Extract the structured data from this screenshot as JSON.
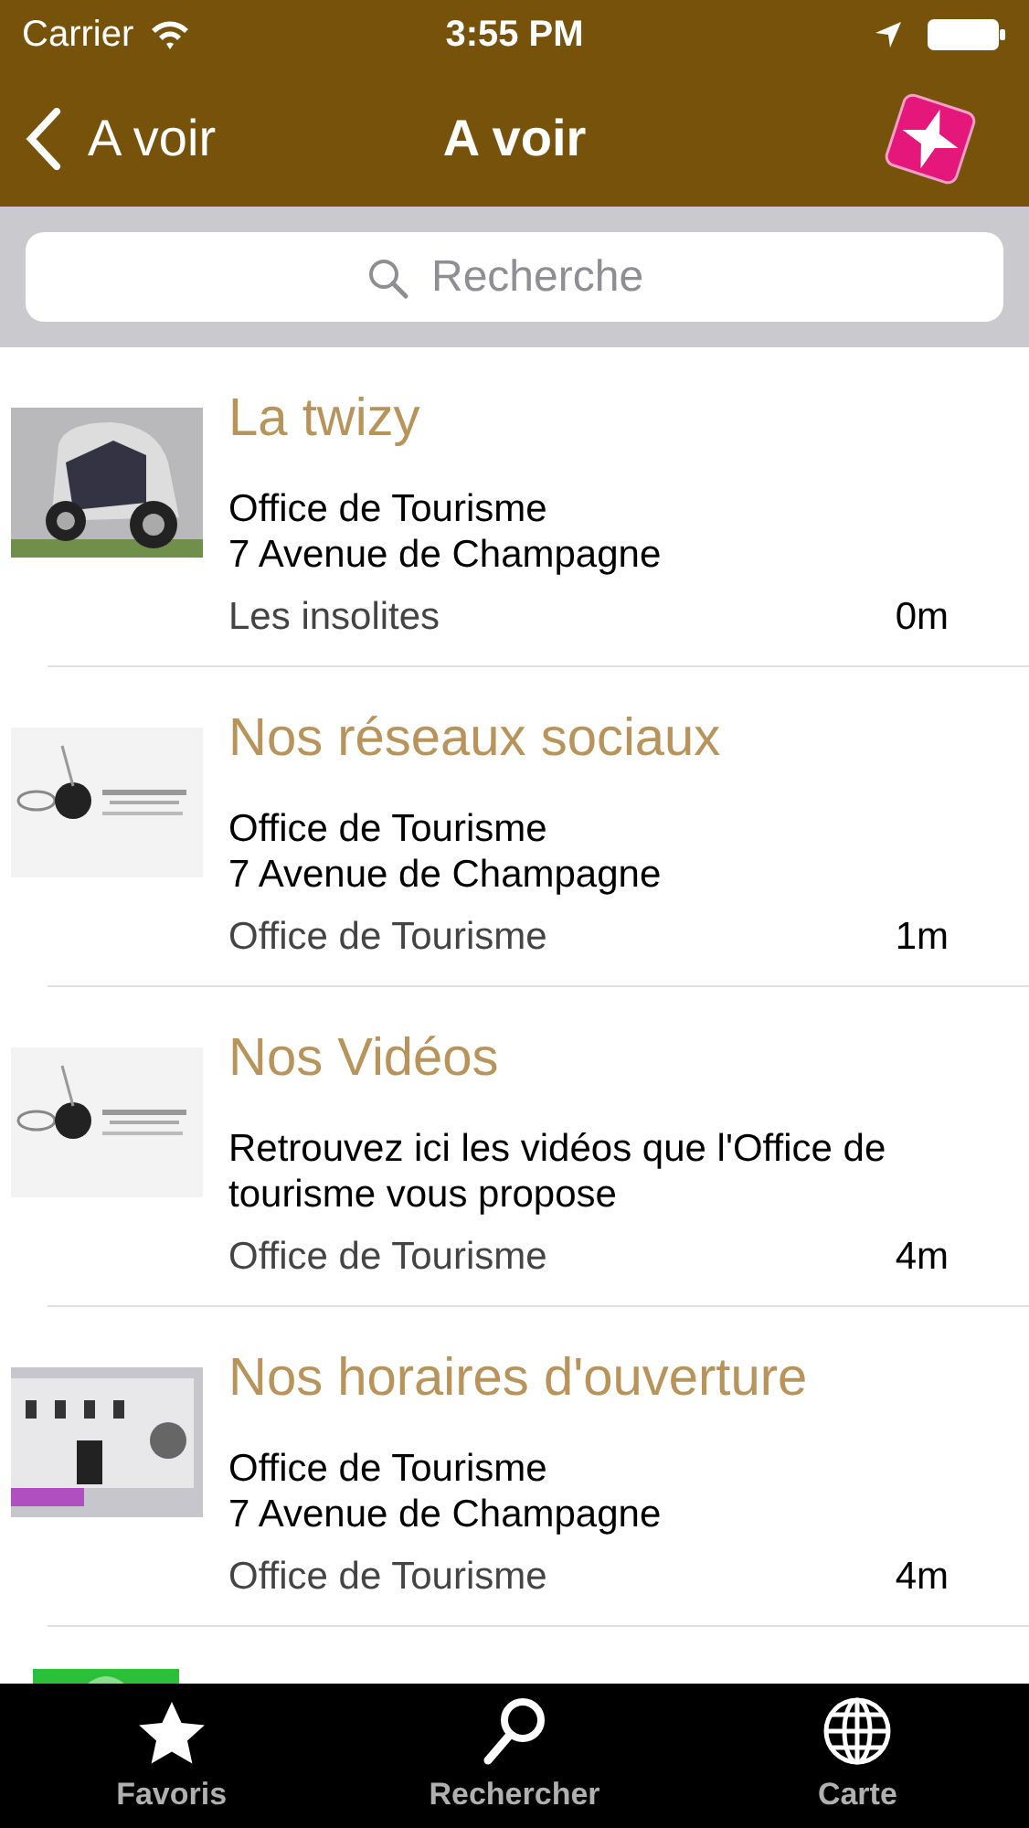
{
  "status_bar": {
    "carrier": "Carrier",
    "time": "3:55 PM"
  },
  "nav": {
    "back": "A voir",
    "title": "A voir"
  },
  "search": {
    "placeholder": "Recherche"
  },
  "items": [
    {
      "title": "La twizy",
      "lines": [
        "Office de Tourisme",
        "7 Avenue de Champagne"
      ],
      "category": "Les insolites",
      "distance": "0m"
    },
    {
      "title": "Nos réseaux sociaux",
      "lines": [
        "Office de Tourisme",
        "7 Avenue de Champagne"
      ],
      "category": "Office de Tourisme",
      "distance": "1m"
    },
    {
      "title": "Nos Vidéos",
      "lines": [
        "Retrouvez ici les vidéos que l'Office de tourisme vous propose"
      ],
      "category": "Office de Tourisme",
      "distance": "4m"
    },
    {
      "title": "Nos horaires d'ouverture",
      "lines": [
        "Office de Tourisme",
        "7 Avenue de Champagne"
      ],
      "category": "Office de Tourisme",
      "distance": "4m"
    }
  ],
  "tabs": [
    {
      "label": "Favoris",
      "kind": "star"
    },
    {
      "label": "Rechercher",
      "kind": "search"
    },
    {
      "label": "Carte",
      "kind": "globe"
    }
  ]
}
